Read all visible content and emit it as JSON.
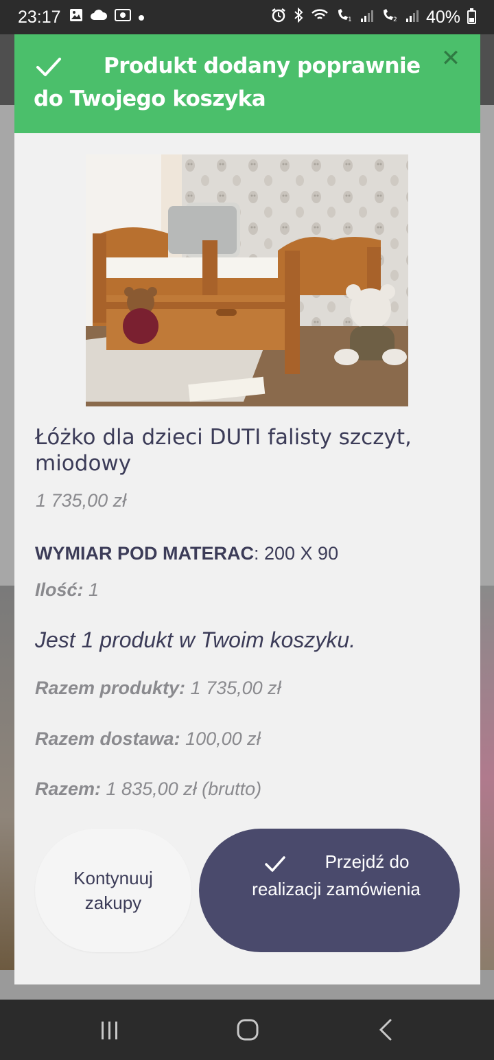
{
  "status_bar": {
    "time": "23:17",
    "battery": "40%",
    "left_icons": [
      "image-icon",
      "cloud-icon",
      "cast-icon",
      "dot-icon"
    ],
    "right_icons": [
      "alarm-icon",
      "bluetooth-icon",
      "wifi-icon",
      "call-sim1-icon",
      "signal-icon",
      "call-sim2-icon",
      "signal-icon"
    ]
  },
  "modal": {
    "title": "Produkt dodany poprawnie do Twojego koszyka",
    "header_color": "#4bbf6b",
    "close_symbol": "✕"
  },
  "product": {
    "name": "Łóżko dla dzieci DUTI falisty szczyt, miodowy",
    "price": "1 735,00 zł",
    "attribute_label": "WYMIAR POD MATERAC",
    "attribute_value": ": 200 X 90",
    "quantity_label": "Ilość:",
    "quantity_value": " 1"
  },
  "cart": {
    "count_text": "Jest 1 produkt w Twoim koszyku.",
    "products_total_label": "Razem produkty:",
    "products_total_value": " 1 735,00 zł",
    "shipping_label": "Razem dostawa:",
    "shipping_value": " 100,00 zł",
    "total_label": "Razem:",
    "total_value": " 1 835,00 zł (brutto)"
  },
  "buttons": {
    "continue_label": "Kontynuuj zakupy",
    "checkout_label": "Przejdź do realizacji zamówienia",
    "checkout_color": "#4a4a6c"
  },
  "nav_bar": {
    "icons": [
      "recent-apps-icon",
      "home-icon",
      "back-icon"
    ]
  }
}
